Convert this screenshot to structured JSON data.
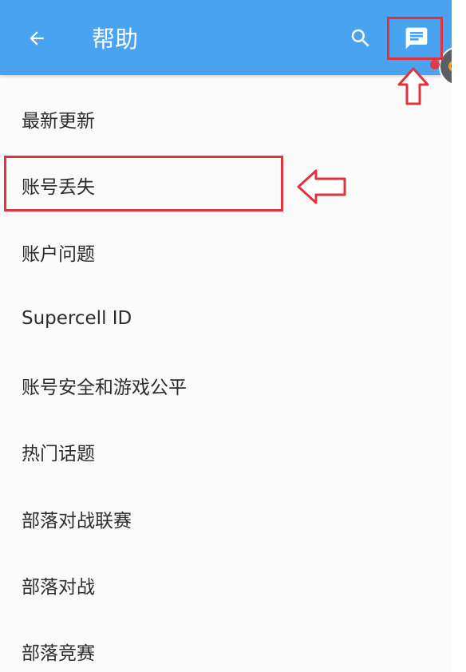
{
  "header": {
    "title": "帮助",
    "back_icon": "arrow-left-icon",
    "search_icon": "search-icon",
    "chat_icon": "message-icon",
    "bar_color": "#4aa3f0"
  },
  "menu": {
    "items": [
      {
        "label": "最新更新"
      },
      {
        "label": "账号丢失"
      },
      {
        "label": "账户问题"
      },
      {
        "label": "Supercell ID"
      },
      {
        "label": "账号安全和游戏公平"
      },
      {
        "label": "热门话题"
      },
      {
        "label": "部落对战联赛"
      },
      {
        "label": "部落对战"
      },
      {
        "label": "部落竞赛"
      }
    ]
  },
  "annotations": {
    "highlight_color": "#e0333d"
  }
}
